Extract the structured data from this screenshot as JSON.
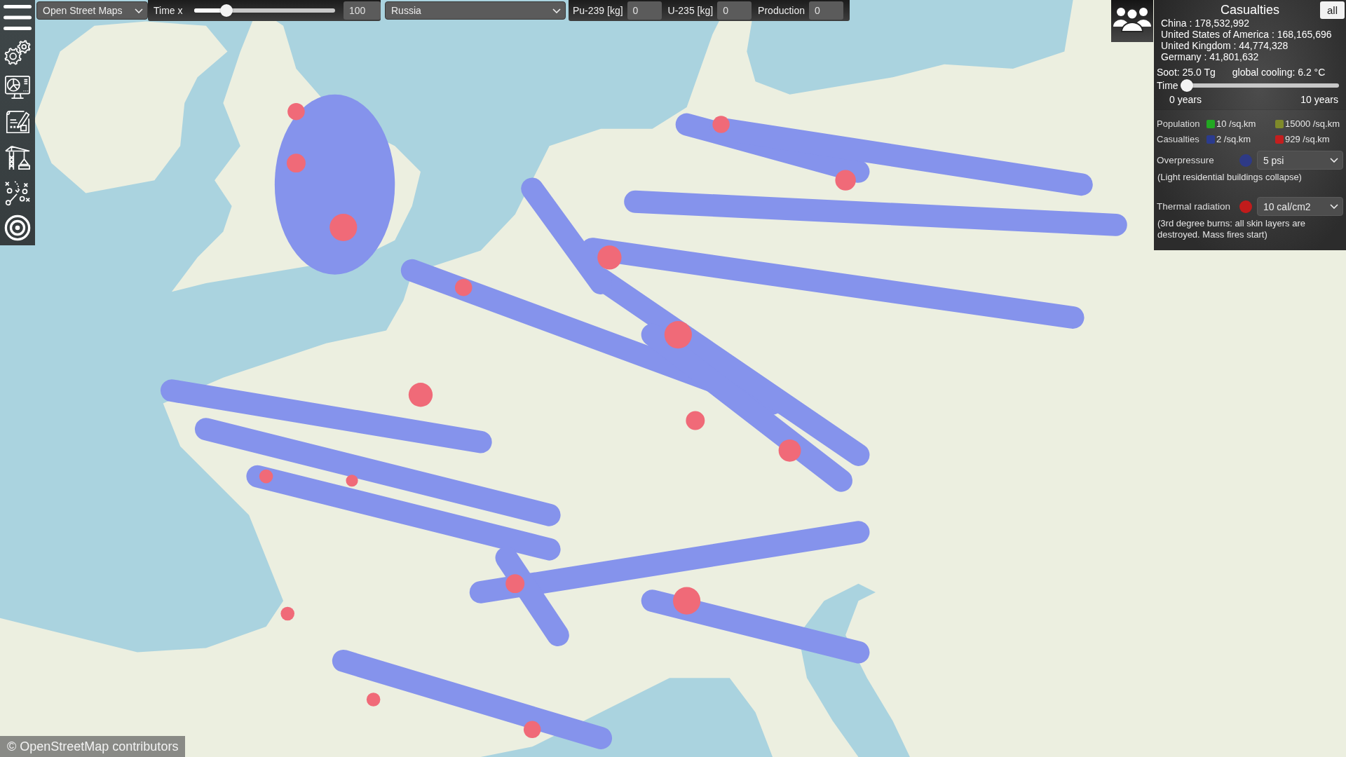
{
  "toolbar": {
    "base_map": {
      "value": "Open Street Maps"
    },
    "time": {
      "label": "Time x",
      "level": 0.2,
      "value": "100"
    },
    "country": {
      "value": "Russia"
    },
    "materials": [
      {
        "label": "Pu-239 [kg]",
        "value": "0"
      },
      {
        "label": "U-235 [kg]",
        "value": "0"
      },
      {
        "label": "Production",
        "value": "0"
      }
    ]
  },
  "casualties_panel": {
    "title": "Casualties",
    "button": "all",
    "countries": [
      "China : 178,532,992",
      "United States of America : 168,165,696",
      "United Kingdom : 44,774,328",
      "Germany : 41,801,632"
    ],
    "soot": "Soot: 25.0 Tg",
    "cooling": "global cooling: 6.2 °C",
    "time": {
      "label": "Time",
      "level": 0,
      "start": "0 years",
      "end": "10 years"
    },
    "legend": [
      {
        "label": "Population",
        "entries": [
          {
            "color": "#22a822",
            "text": "10 /sq.km"
          },
          {
            "color": "#7f8a2a",
            "text": "15000 /sq.km"
          }
        ]
      },
      {
        "label": "Casualties",
        "entries": [
          {
            "color": "#2b3b8e",
            "text": "2 /sq.km"
          },
          {
            "color": "#c41e1e",
            "text": "929 /sq.km"
          }
        ]
      }
    ],
    "effects": [
      {
        "label": "Overpressure",
        "color": "#2e3a86",
        "value": "5 psi",
        "description": "(Light residential buildings collapse)"
      },
      {
        "label": "Thermal radiation",
        "color": "#c11b1b",
        "value": "10 cal/cm2",
        "description": "(3rd degree burns: all skin layers are destroyed. Mass fires start)"
      }
    ]
  },
  "attribution": "© OpenStreetMap contributors"
}
